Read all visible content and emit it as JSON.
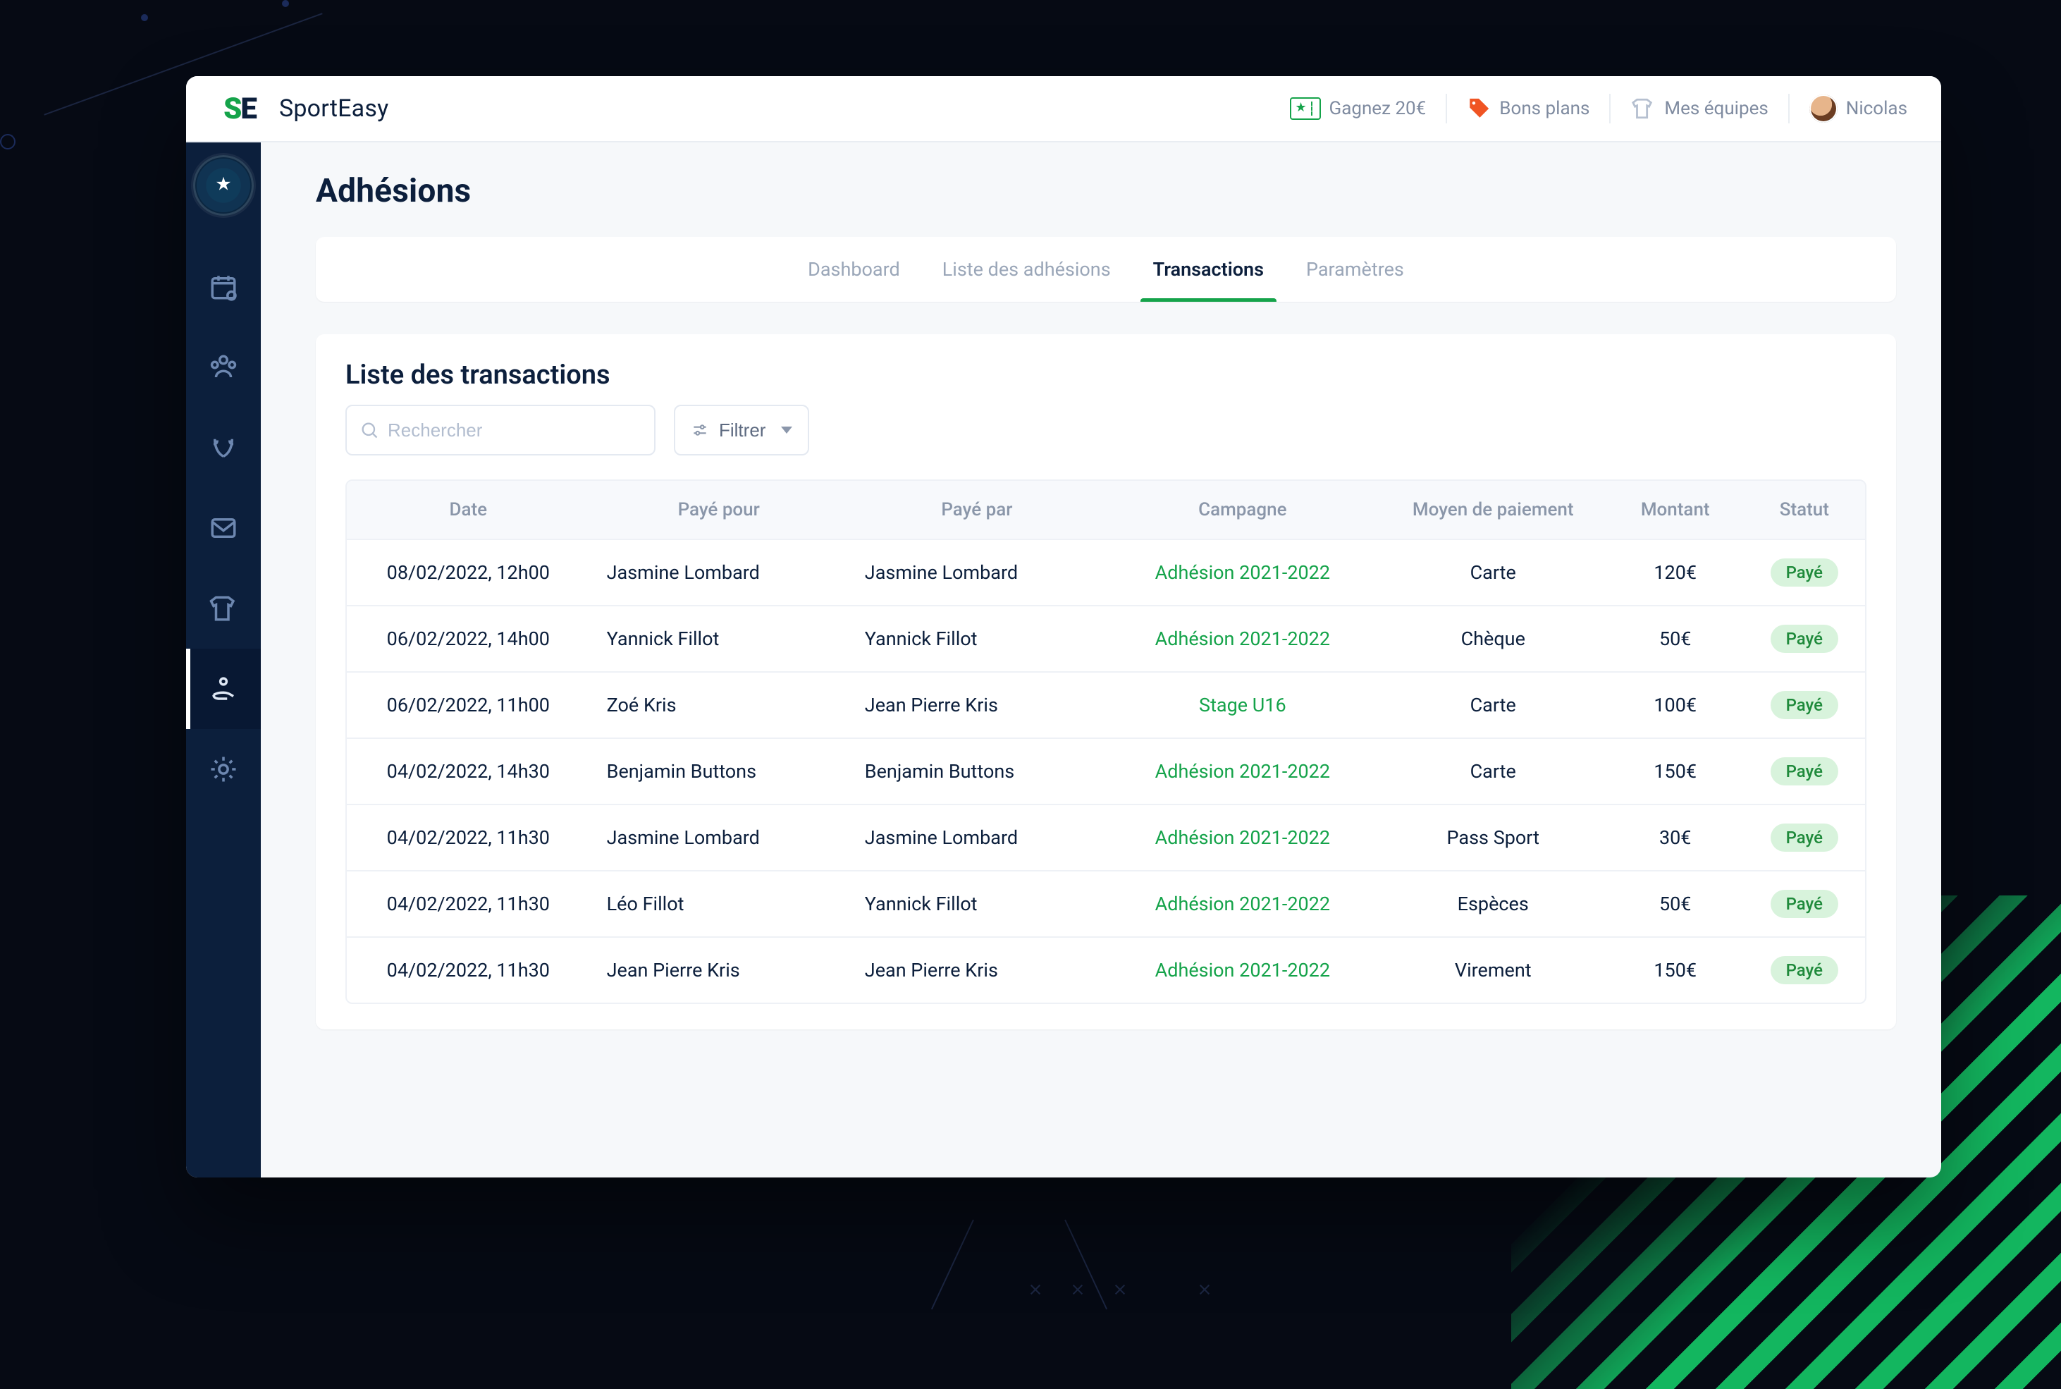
{
  "brand": {
    "name": "SportEasy",
    "mark_left": "S",
    "mark_right": "E"
  },
  "topbar": {
    "earn_label": "Gagnez 20€",
    "deals_label": "Bons plans",
    "teams_label": "Mes équipes",
    "user_name": "Nicolas"
  },
  "page": {
    "title": "Adhésions"
  },
  "tabs": {
    "dashboard": "Dashboard",
    "members": "Liste des adhésions",
    "transactions": "Transactions",
    "settings": "Paramètres",
    "active": "transactions"
  },
  "panel": {
    "title": "Liste des transactions"
  },
  "search": {
    "placeholder": "Rechercher",
    "value": ""
  },
  "filter": {
    "label": "Filtrer"
  },
  "columns": {
    "date": "Date",
    "payee": "Payé pour",
    "payer": "Payé par",
    "campaign": "Campagne",
    "means": "Moyen de paiement",
    "amount": "Montant",
    "status": "Statut"
  },
  "status_labels": {
    "paid": "Payé"
  },
  "rows": [
    {
      "date": "08/02/2022, 12h00",
      "payee": "Jasmine Lombard",
      "payer": "Jasmine Lombard",
      "campaign": "Adhésion 2021-2022",
      "means": "Carte",
      "amount": "120€",
      "status": "paid"
    },
    {
      "date": "06/02/2022, 14h00",
      "payee": "Yannick Fillot",
      "payer": "Yannick Fillot",
      "campaign": "Adhésion 2021-2022",
      "means": "Chèque",
      "amount": "50€",
      "status": "paid"
    },
    {
      "date": "06/02/2022, 11h00",
      "payee": "Zoé Kris",
      "payer": "Jean Pierre Kris",
      "campaign": "Stage U16",
      "means": "Carte",
      "amount": "100€",
      "status": "paid"
    },
    {
      "date": "04/02/2022, 14h30",
      "payee": "Benjamin Buttons",
      "payer": "Benjamin Buttons",
      "campaign": "Adhésion 2021-2022",
      "means": "Carte",
      "amount": "150€",
      "status": "paid"
    },
    {
      "date": "04/02/2022, 11h30",
      "payee": "Jasmine Lombard",
      "payer": "Jasmine Lombard",
      "campaign": "Adhésion 2021-2022",
      "means": "Pass Sport",
      "amount": "30€",
      "status": "paid"
    },
    {
      "date": "04/02/2022, 11h30",
      "payee": "Léo Fillot",
      "payer": "Yannick Fillot",
      "campaign": "Adhésion 2021-2022",
      "means": "Espèces",
      "amount": "50€",
      "status": "paid"
    },
    {
      "date": "04/02/2022, 11h30",
      "payee": "Jean Pierre Kris",
      "payer": "Jean Pierre Kris",
      "campaign": "Adhésion 2021-2022",
      "means": "Virement",
      "amount": "150€",
      "status": "paid"
    }
  ]
}
